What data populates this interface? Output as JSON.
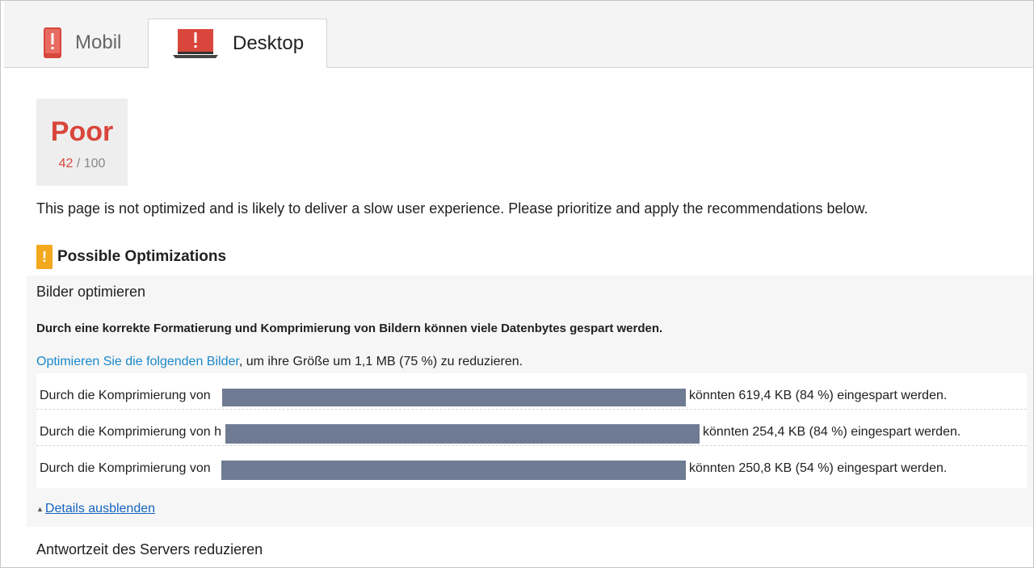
{
  "tabs": [
    {
      "label": "Mobil",
      "icon": "mobile-warning-icon",
      "active": false
    },
    {
      "label": "Desktop",
      "icon": "desktop-warning-icon",
      "active": true
    }
  ],
  "score": {
    "label": "Poor",
    "value": "42",
    "max": "/ 100",
    "color": "#d9463c"
  },
  "summary": "This page is not optimized and is likely to deliver a slow user experience. Please prioritize and apply the recommendations below.",
  "optimizations": {
    "heading": "Possible Optimizations",
    "badge": "!",
    "badge_color": "#f3a81d"
  },
  "rule": {
    "title": "Bilder optimieren",
    "description": "Durch eine korrekte Formatierung und Komprimierung von Bildern können viele Datenbytes gespart werden.",
    "link_text": "Optimieren Sie die folgenden Bilder",
    "link_suffix": ", um ihre Größe um 1,1 MB (75 %) zu reduzieren.",
    "items": [
      {
        "lead": "Durch die Komprimierung von",
        "trail": "könnten 619,4 KB (84 %) eingespart werden."
      },
      {
        "lead": "Durch die Komprimierung von h",
        "trail": "könnten 254,4 KB (84 %) eingespart werden."
      },
      {
        "lead": "Durch die Komprimierung von",
        "trail": "könnten 250,8 KB (54 %) eingespart werden."
      }
    ],
    "toggle_label": "Details ausblenden"
  },
  "rule2": {
    "title": "Antwortzeit des Servers reduzieren"
  }
}
